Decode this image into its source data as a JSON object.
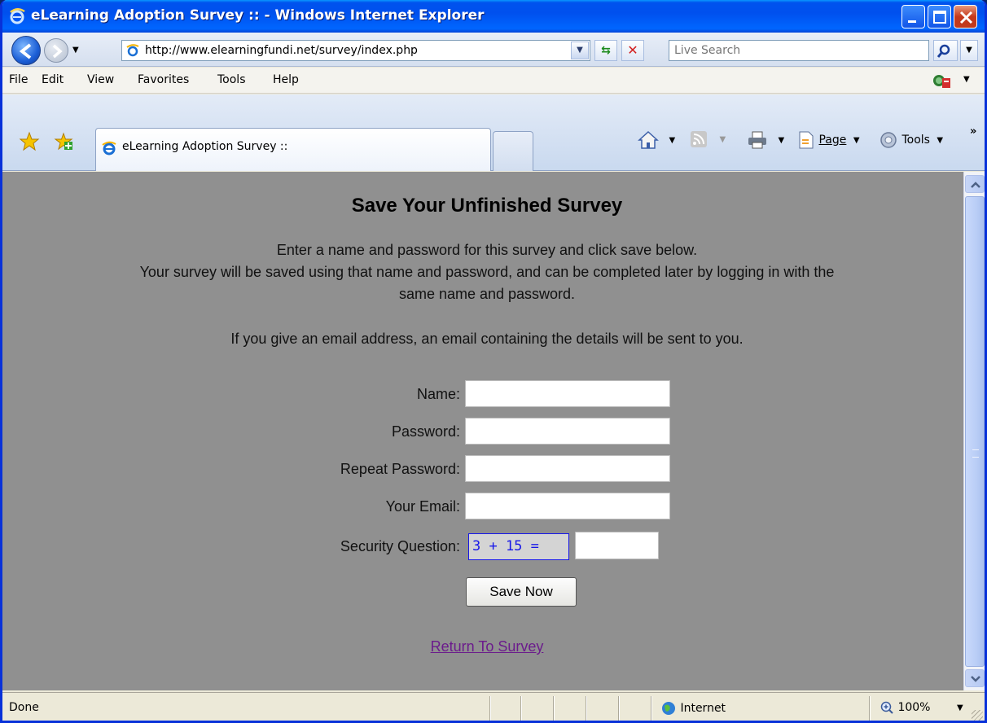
{
  "window": {
    "title": "eLearning Adoption Survey :: - Windows Internet Explorer"
  },
  "addressbar": {
    "url": "http://www.elearningfundi.net/survey/index.php",
    "search_placeholder": "Live Search"
  },
  "menu": {
    "items": [
      {
        "label": "File",
        "accel": "F"
      },
      {
        "label": "Edit",
        "accel": "E"
      },
      {
        "label": "View",
        "accel": "V"
      },
      {
        "label": "Favorites",
        "accel": "a"
      },
      {
        "label": "Tools",
        "accel": "T"
      },
      {
        "label": "Help",
        "accel": "H"
      }
    ]
  },
  "tabs": {
    "active_tab": "eLearning Adoption Survey ::"
  },
  "commandbar": {
    "page_label": "Page",
    "tools_label": "Tools"
  },
  "page": {
    "heading": "Save Your Unfinished Survey",
    "intro_line1": "Enter a name and password for this survey and click save below.",
    "intro_line2": "Your survey will be saved using that name and password, and can be completed later by logging in with the",
    "intro_line3": "same name and password.",
    "email_note": "If you give an email address, an email containing the details will be sent to you.",
    "form": {
      "name_label": "Name:",
      "password_label": "Password:",
      "repeat_password_label": "Repeat Password:",
      "email_label": "Your Email:",
      "security_label": "Security Question:",
      "security_question": "3 + 15 =",
      "name_value": "",
      "password_value": "",
      "repeat_password_value": "",
      "email_value": "",
      "security_answer_value": ""
    },
    "save_button": "Save Now",
    "return_link": "Return To Survey"
  },
  "statusbar": {
    "status": "Done",
    "zone": "Internet",
    "zoom": "100%"
  },
  "colors": {
    "content_bg": "#909090",
    "link": "#6b1b8c",
    "captcha_text": "#1717e8",
    "titlebar": "#0050ee"
  }
}
